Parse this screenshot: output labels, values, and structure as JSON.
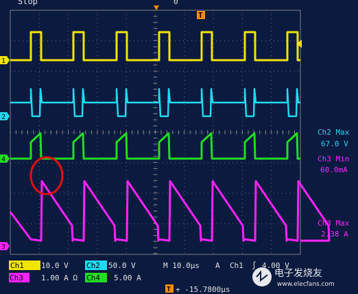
{
  "status": {
    "run_state": "Stop",
    "trigger_marker": "0"
  },
  "trigger_icon": "T",
  "channels": [
    {
      "id": "1",
      "color": "#f2e600"
    },
    {
      "id": "2",
      "color": "#22d8f0"
    },
    {
      "id": "4",
      "color": "#22dd22"
    },
    {
      "id": "3",
      "color": "#ff22ff"
    }
  ],
  "measurements": [
    {
      "label": "Ch2 Max",
      "value": "67.0 V",
      "color": "#22d8f0"
    },
    {
      "label": "Ch3 Min",
      "value": "60.0mA",
      "color": "#ff22ff"
    },
    {
      "label": "Ch3 Max",
      "value": "2.38 A",
      "color": "#ff22ff"
    }
  ],
  "settings": {
    "ch1_label": "Ch1",
    "ch1_scale": "10.0 V",
    "ch2_label": "Ch2",
    "ch2_scale": "50.0 V",
    "ch3_label": "Ch3",
    "ch3_scale": "1.00 A Ω",
    "ch4_label": "Ch4",
    "ch4_scale": "5.00 A",
    "timebase": "M 10.0µs",
    "trigger_mode": "A",
    "trigger_source": "Ch1",
    "trigger_slope": "∫",
    "trigger_level": "4.00 V",
    "horiz_pos_icon": "T",
    "horiz_position": "+ -15.7800µs"
  },
  "watermark": "电子发烧友",
  "watermark_site": "www.elecfans.com",
  "annotation": {
    "shape": "red-circle"
  },
  "icons": [
    "trigger-marker-icon",
    "trigger-T-icon",
    "slope-icon",
    "watermark-logo-icon",
    "circle-annotation-icon"
  ]
}
